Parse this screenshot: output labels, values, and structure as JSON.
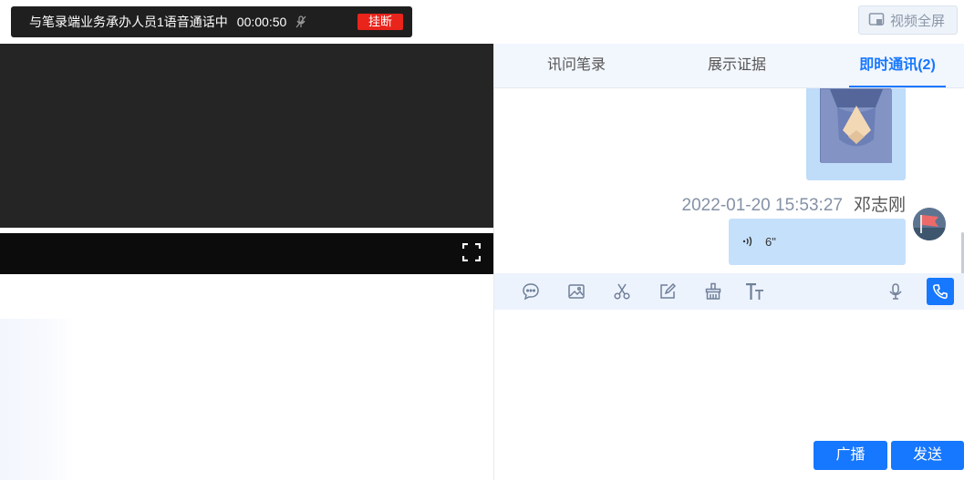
{
  "call_bar": {
    "status_text": "与笔录端业务承办人员1语音通话中",
    "timer": "00:00:50",
    "hangup_label": "挂断"
  },
  "header": {
    "fullscreen_label": "视频全屏"
  },
  "tabs": [
    {
      "label": "讯问笔录",
      "active": false
    },
    {
      "label": "展示证据",
      "active": false
    },
    {
      "label": "即时通讯(2)",
      "active": true
    }
  ],
  "messages": {
    "timestamp": "2022-01-20 15:53:27",
    "sender": "邓志刚",
    "voice_duration": "6\""
  },
  "toolbar": {
    "icons": [
      "chat-icon",
      "image-icon",
      "scissors-icon",
      "edit-icon",
      "clear-brush-icon",
      "text-size-icon",
      "microphone-icon",
      "phone-icon"
    ]
  },
  "actions": {
    "broadcast_label": "广播",
    "send_label": "发送"
  },
  "colors": {
    "accent": "#1677ff",
    "hangup": "#e9241b",
    "bubble": "#c5e0fb",
    "tab_bar": "#f2f6fd"
  }
}
